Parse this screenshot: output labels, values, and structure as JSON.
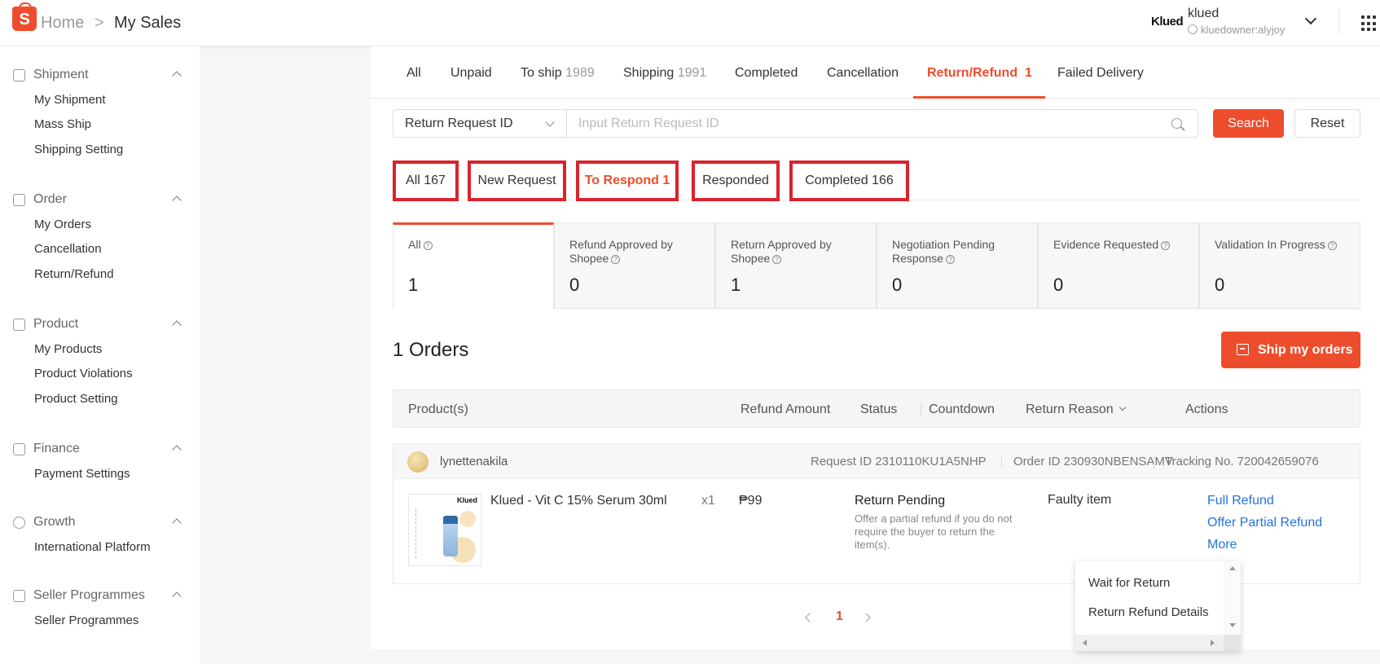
{
  "header": {
    "logo_letter": "S",
    "breadcrumb_home": "Home",
    "breadcrumb_sep": ">",
    "breadcrumb_current": "My Sales",
    "shop_logo_text": "Klued",
    "shop_name": "klued",
    "shop_sub": "kluedowner:alyjoy"
  },
  "sidebar": {
    "sections": [
      {
        "title": "Shipment",
        "icon": "box-icon",
        "items": [
          "My Shipment",
          "Mass Ship",
          "Shipping Setting"
        ]
      },
      {
        "title": "Order",
        "icon": "clipboard-icon",
        "items": [
          "My Orders",
          "Cancellation",
          "Return/Refund"
        ]
      },
      {
        "title": "Product",
        "icon": "bag-icon",
        "items": [
          "My Products",
          "Product Violations",
          "Product Setting"
        ]
      },
      {
        "title": "Finance",
        "icon": "wallet-icon",
        "items": [
          "Payment Settings"
        ]
      },
      {
        "title": "Growth",
        "icon": "medal-icon",
        "items": [
          "International Platform"
        ]
      },
      {
        "title": "Seller Programmes",
        "icon": "puzzle-icon",
        "items": [
          "Seller Programmes"
        ]
      }
    ]
  },
  "tabs": [
    {
      "label": "All",
      "count": ""
    },
    {
      "label": "Unpaid",
      "count": ""
    },
    {
      "label": "To ship",
      "count": "1989"
    },
    {
      "label": "Shipping",
      "count": "1991"
    },
    {
      "label": "Completed",
      "count": ""
    },
    {
      "label": "Cancellation",
      "count": ""
    },
    {
      "label": "Return/Refund",
      "count": "1"
    },
    {
      "label": "Failed Delivery",
      "count": ""
    }
  ],
  "search": {
    "select_value": "Return Request ID",
    "input_placeholder": "Input Return Request ID",
    "input_value": "",
    "search_label": "Search",
    "reset_label": "Reset"
  },
  "subtabs": [
    "All 167",
    "New Request",
    "To Respond 1",
    "Responded",
    "Completed 166"
  ],
  "stats": [
    {
      "label": "All",
      "value": "1"
    },
    {
      "label": "Refund Approved by Shopee",
      "value": "0"
    },
    {
      "label": "Return Approved by Shopee",
      "value": "1"
    },
    {
      "label": "Negotiation Pending Response",
      "value": "0"
    },
    {
      "label": "Evidence Requested",
      "value": "0"
    },
    {
      "label": "Validation In Progress",
      "value": "0"
    }
  ],
  "orders": {
    "title": "1 Orders",
    "ship_label": "Ship my orders"
  },
  "table_headers": {
    "product": "Product(s)",
    "refund": "Refund Amount",
    "status": "Status",
    "countdown": "Countdown",
    "reason": "Return Reason",
    "actions": "Actions"
  },
  "order": {
    "buyer": "lynettenakila",
    "request_id": "Request ID 2310110KU1A5NHP",
    "order_id": "Order ID 230930NBENSAMV",
    "tracking": "Tracking No. 720042659076",
    "product_brand": "Klued",
    "product_name": "Klued - Vit C 15% Serum 30ml",
    "qty": "x1",
    "price": "₱99",
    "status": "Return Pending",
    "status_note": "Offer a partial refund if you do not require the buyer to return the item(s).",
    "reason": "Faulty item",
    "actions": [
      "Full Refund",
      "Offer Partial Refund",
      "More"
    ]
  },
  "pagination": {
    "current": "1"
  },
  "dropdown": {
    "items": [
      "Wait for Return",
      "Return Refund Details"
    ]
  },
  "colors": {
    "accent": "#ee4d2d",
    "link": "#2673dd",
    "highlight_box": "#d9232d"
  }
}
